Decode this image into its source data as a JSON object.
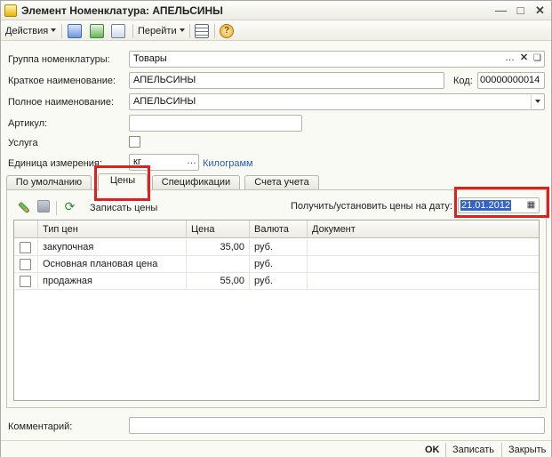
{
  "window": {
    "title": "Элемент Номенклатура: АПЕЛЬСИНЫ"
  },
  "toolbar": {
    "actions_label": "Действия",
    "goto_label": "Перейти"
  },
  "form": {
    "group_label": "Группа номенклатуры:",
    "group_value": "Товары",
    "short_name_label": "Краткое наименование:",
    "short_name_value": "АПЕЛЬСИНЫ",
    "code_label": "Код:",
    "code_value": "00000000014",
    "full_name_label": "Полное наименование:",
    "full_name_value": "АПЕЛЬСИНЫ",
    "article_label": "Артикул:",
    "article_value": "",
    "service_label": "Услуга",
    "unit_label": "Единица измерения:",
    "unit_value": "кг",
    "unit_link": "Килограмм",
    "comment_label": "Комментарий:",
    "comment_value": ""
  },
  "tabs": [
    {
      "label": "По умолчанию"
    },
    {
      "label": "Цены"
    },
    {
      "label": "Спецификации"
    },
    {
      "label": "Счета учета"
    }
  ],
  "prices_panel": {
    "write_prices_label": "Записать цены",
    "date_label": "Получить/установить цены на дату:",
    "date_value": "21.01.2012"
  },
  "table": {
    "columns": [
      "Тип цен",
      "Цена",
      "Валюта",
      "Документ"
    ],
    "rows": [
      {
        "type": "закупочная",
        "price": "35,00",
        "currency": "руб.",
        "document": ""
      },
      {
        "type": "Основная плановая цена",
        "price": "",
        "currency": "руб.",
        "document": ""
      },
      {
        "type": "продажная",
        "price": "55,00",
        "currency": "руб.",
        "document": ""
      }
    ]
  },
  "bottom": {
    "ok_label": "OK",
    "save_label": "Записать",
    "close_label": "Закрыть"
  },
  "colors": {
    "highlight": "#e01f1f",
    "link": "#2a5bb8",
    "selection": "#3163c8"
  },
  "icons": [
    "app-icon",
    "minimize-icon",
    "maximize-icon",
    "close-icon",
    "move-up-icon",
    "refresh-list-icon",
    "copy-icon",
    "list-icon",
    "help-icon",
    "edit-icon",
    "save-icon",
    "refresh-icon",
    "calendar-icon",
    "clear-icon",
    "select-icon"
  ]
}
